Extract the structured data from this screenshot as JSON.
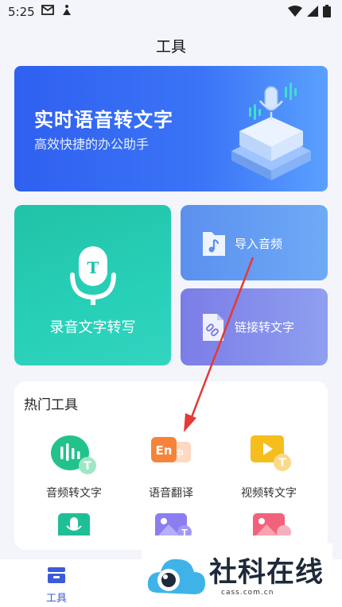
{
  "status_bar": {
    "time": "5:25"
  },
  "page": {
    "title": "工具"
  },
  "hero": {
    "title": "实时语音转文字",
    "subtitle": "高效快捷的办公助手"
  },
  "cards": {
    "record": "录音文字转写",
    "import_audio": "导入音频",
    "link_to_text": "链接转文字"
  },
  "hot_tools": {
    "title": "热门工具",
    "items": [
      {
        "label": "音频转文字",
        "icon": "audio-bars-icon"
      },
      {
        "label": "语音翻译",
        "icon": "translate-icon"
      },
      {
        "label": "视频转文字",
        "icon": "video-text-icon"
      }
    ]
  },
  "tabbar": {
    "tools_label": "工具"
  },
  "watermark": {
    "text": "社科在线",
    "url": "cass.com.cn"
  },
  "colors": {
    "accent": "#3b5bdb",
    "hero": "#2f60f0",
    "record_card": "#22c2a6",
    "arrow": "#e53935"
  }
}
